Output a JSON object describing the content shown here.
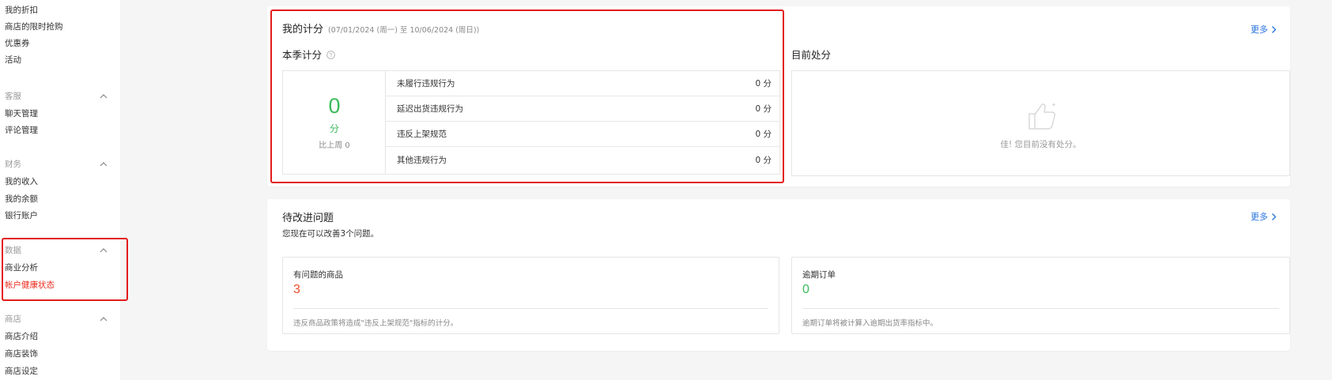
{
  "sidebar": {
    "top_items": [
      "我的折扣",
      "商店的限时抢购",
      "优惠券",
      "活动"
    ],
    "groups": [
      {
        "title": "客服",
        "items": [
          "聊天管理",
          "评论管理"
        ]
      },
      {
        "title": "财务",
        "items": [
          "我的收入",
          "我的余额",
          "银行账户"
        ]
      },
      {
        "title": "数据",
        "items": [
          "商业分析",
          "帐户健康状态"
        ],
        "active_item": "帐户健康状态"
      },
      {
        "title": "商店",
        "items": [
          "商店介绍",
          "商店装饰",
          "商店设定"
        ]
      }
    ]
  },
  "score_card": {
    "title": "我的计分",
    "date_range": "(07/01/2024 (周一) 至 10/06/2024 (周日))",
    "more_label": "更多",
    "season_title": "本季计分",
    "score_value": "0",
    "score_unit": "分",
    "compare_text": "比上周 0",
    "violations": [
      {
        "label": "未履行违规行为",
        "value": "0 分"
      },
      {
        "label": "延迟出货违规行为",
        "value": "0 分"
      },
      {
        "label": "违反上架规范",
        "value": "0 分"
      },
      {
        "label": "其他违规行为",
        "value": "0 分"
      }
    ],
    "penalty_title": "目前处分",
    "penalty_empty_text": "佳! 您目前没有处分。"
  },
  "issues_card": {
    "title": "待改进问题",
    "more_label": "更多",
    "summary": "您现在可以改善3个问题。",
    "items": [
      {
        "title": "有问题的商品",
        "count": "3",
        "count_color": "#ee4d2d",
        "note": "违反商品政策将造成\"违反上架规范\"指标的计分。"
      },
      {
        "title": "逾期订单",
        "count": "0",
        "count_color": "#3cba5b",
        "note": "逾期订单将被计算入逾期出货率指标中。"
      }
    ]
  },
  "colors": {
    "highlight": "#e31b1b",
    "link": "#2673dd",
    "good": "#3cba5b",
    "bad": "#ee4d2d"
  }
}
